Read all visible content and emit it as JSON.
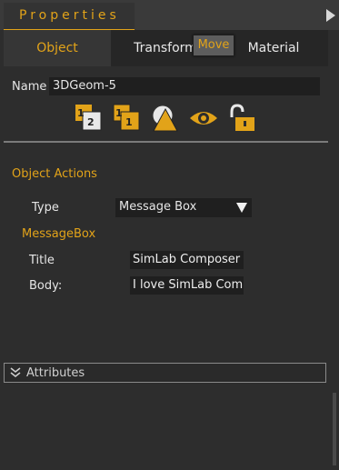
{
  "panel": {
    "title": "Properties"
  },
  "tabs": [
    {
      "label": "Object"
    },
    {
      "label": "Transform"
    },
    {
      "label": "Material"
    }
  ],
  "tooltip": {
    "text": "Move"
  },
  "name": {
    "label": "Name",
    "value": "3DGeom-5"
  },
  "toolbar_icons": [
    "layer-1-2-icon",
    "layer-1-1-icon",
    "shape-visibility-icon",
    "eye-icon",
    "unlock-icon"
  ],
  "object_actions": {
    "title": "Object Actions",
    "type_label": "Type",
    "type_value": "Message Box"
  },
  "message_box": {
    "title": "MessageBox",
    "title_label": "Title",
    "title_value": "SimLab Composer",
    "body_label": "Body:",
    "body_value": "I love SimLab Composer"
  },
  "attributes": {
    "label": "Attributes"
  },
  "colors": {
    "accent": "#e2a319",
    "background": "#2d2d2d",
    "field": "#1f1f1f"
  }
}
